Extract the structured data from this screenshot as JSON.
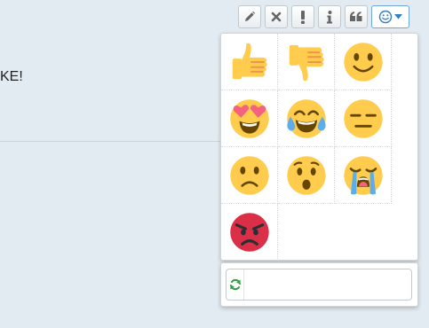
{
  "page": {
    "partial_text": "KE!"
  },
  "toolbar": {
    "buttons": [
      {
        "name": "edit",
        "icon": "pencil-icon"
      },
      {
        "name": "delete",
        "icon": "times-icon"
      },
      {
        "name": "report",
        "icon": "exclamation-icon"
      },
      {
        "name": "info",
        "icon": "info-icon"
      },
      {
        "name": "quote",
        "icon": "quote-icon"
      },
      {
        "name": "emoji",
        "icon": "smiley-icon"
      }
    ]
  },
  "emoji_picker": {
    "emojis": [
      "thumbs-up",
      "thumbs-down",
      "smiling-face",
      "heart-eyes-face",
      "tears-of-joy-face",
      "expressionless-face",
      "slightly-frowning-face",
      "hushed-face",
      "loudly-crying-face",
      "pouting-face"
    ],
    "search_value": ""
  },
  "colors": {
    "emoji_yellow": "#FFCC4D",
    "feature_brown": "#664500",
    "pouting_red": "#DA2F47",
    "tear_blue": "#5DADEC",
    "heart_red": "#F4627F",
    "refresh_green": "#2E9E3F",
    "trigger_border": "#6EA7D8"
  }
}
